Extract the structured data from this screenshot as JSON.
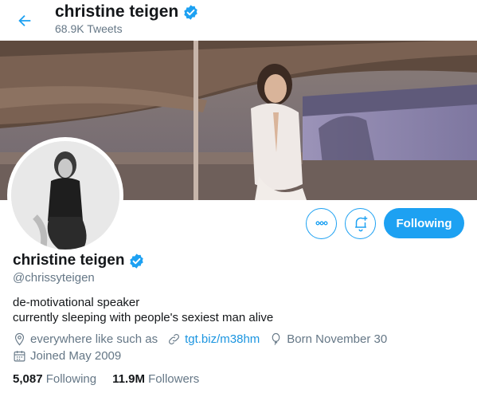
{
  "header": {
    "name": "christine teigen",
    "tweet_count": "68.9K Tweets"
  },
  "actions": {
    "more_label": "more options",
    "notify_label": "turn on notifications",
    "following_label": "Following"
  },
  "profile": {
    "name": "christine teigen",
    "handle": "@chrissyteigen",
    "bio_line1": "de-motivational speaker",
    "bio_line2": "currently sleeping with people's sexiest man alive",
    "location": "everywhere like such as",
    "website": "tgt.biz/m38hm",
    "birthday": "Born November 30",
    "joined": "Joined May 2009"
  },
  "stats": {
    "following_count": "5,087",
    "following_label": "Following",
    "followers_count": "11.9M",
    "followers_label": "Followers"
  },
  "colors": {
    "accent": "#1da1f2",
    "link": "#1b95e0",
    "muted": "#657786",
    "text": "#14171a"
  },
  "icons": {
    "back": "arrow-left-icon",
    "verified": "verified-badge-icon",
    "more": "ellipsis-icon",
    "notify": "bell-plus-icon",
    "location": "location-pin-icon",
    "link": "link-icon",
    "birthday": "balloon-icon",
    "calendar": "calendar-icon"
  }
}
